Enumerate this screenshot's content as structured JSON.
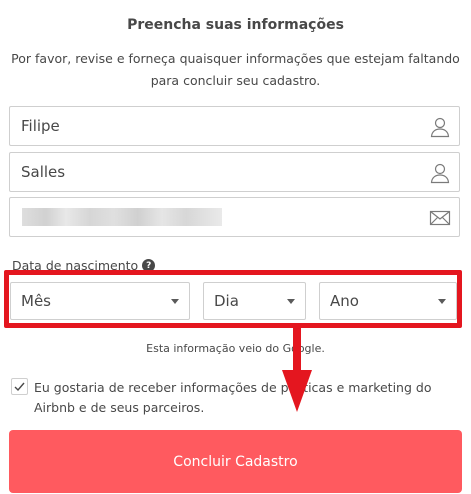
{
  "header": {
    "title": "Preencha suas informações",
    "subtitle": "Por favor, revise e forneça quaisquer informações que estejam faltando para concluir seu cadastro."
  },
  "form": {
    "first_name": "Filipe",
    "last_name": "Salles",
    "email_redacted": true,
    "dob_label": "Data de nascimento",
    "month": "Mês",
    "day": "Dia",
    "year": "Ano",
    "source_note": "Esta informação veio do Google.",
    "marketing_opt_in": "Eu gostaria de receber informações de políticas e marketing do Airbnb e de seus parceiros.",
    "marketing_checked": true,
    "submit_label": "Concluir Cadastro"
  },
  "colors": {
    "brand": "#ff5a5f",
    "annotation": "#e4161f"
  },
  "icons": [
    "person-icon",
    "person-icon",
    "envelope-icon",
    "help-icon",
    "check-icon"
  ]
}
